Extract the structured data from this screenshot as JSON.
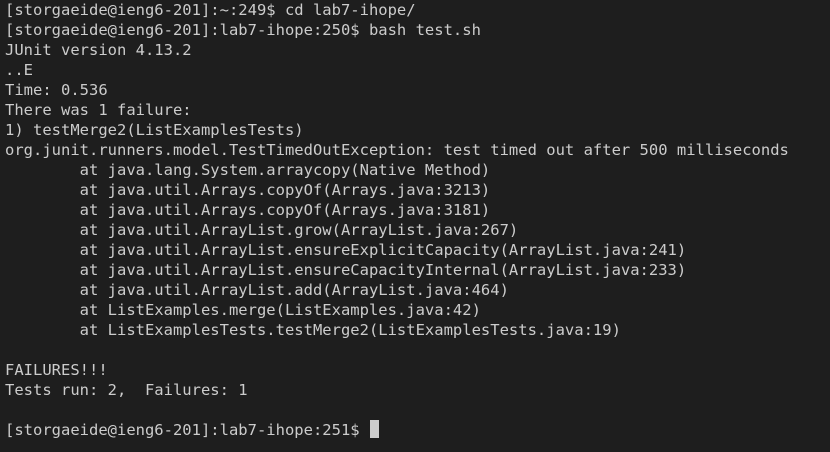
{
  "terminal": {
    "lines": [
      "[storgaeide@ieng6-201]:~:249$ cd lab7-ihope/",
      "[storgaeide@ieng6-201]:lab7-ihope:250$ bash test.sh",
      "JUnit version 4.13.2",
      "..E",
      "Time: 0.536",
      "There was 1 failure:",
      "1) testMerge2(ListExamplesTests)",
      "org.junit.runners.model.TestTimedOutException: test timed out after 500 milliseconds",
      "        at java.lang.System.arraycopy(Native Method)",
      "        at java.util.Arrays.copyOf(Arrays.java:3213)",
      "        at java.util.Arrays.copyOf(Arrays.java:3181)",
      "        at java.util.ArrayList.grow(ArrayList.java:267)",
      "        at java.util.ArrayList.ensureExplicitCapacity(ArrayList.java:241)",
      "        at java.util.ArrayList.ensureCapacityInternal(ArrayList.java:233)",
      "        at java.util.ArrayList.add(ArrayList.java:464)",
      "        at ListExamples.merge(ListExamples.java:42)",
      "        at ListExamplesTests.testMerge2(ListExamplesTests.java:19)",
      "",
      "FAILURES!!!",
      "Tests run: 2,  Failures: 1",
      ""
    ],
    "prompt": "[storgaeide@ieng6-201]:lab7-ihope:251$ ",
    "colors": {
      "background": "#1e1e1e",
      "foreground": "#cccccc"
    }
  }
}
